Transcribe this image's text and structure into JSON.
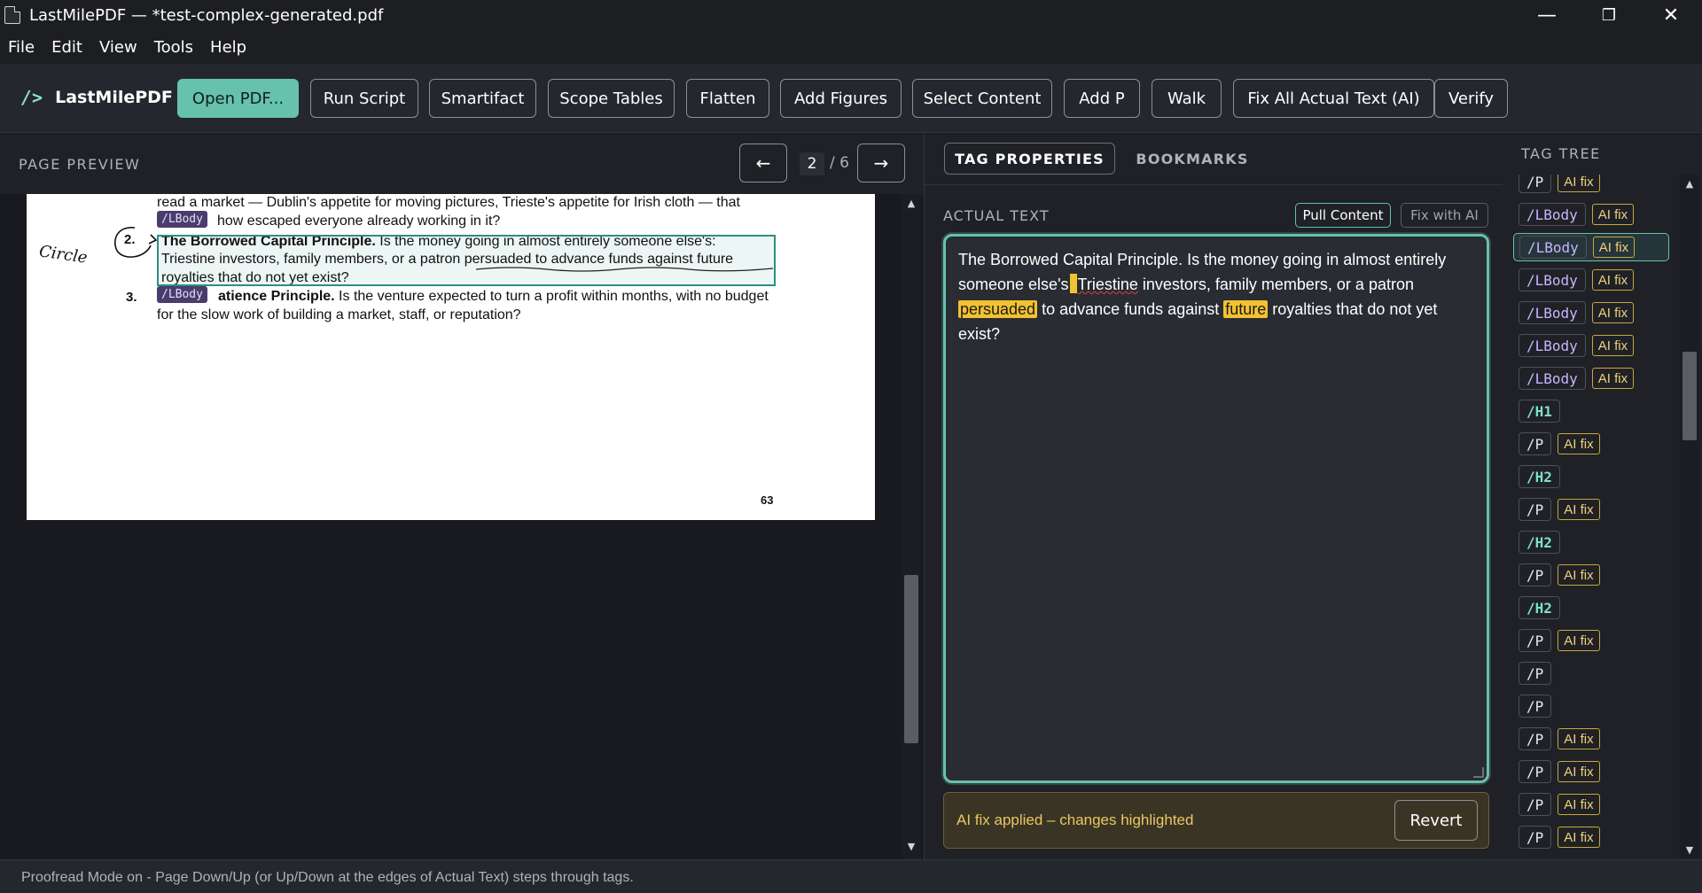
{
  "window": {
    "title": "LastMilePDF — *test-complex-generated.pdf",
    "minimize": "—",
    "maximize": "❐",
    "close": "✕"
  },
  "menu": [
    "File",
    "Edit",
    "View",
    "Tools",
    "Help"
  ],
  "brand": {
    "mark": "/>",
    "name": "LastMilePDF"
  },
  "toolbar": {
    "buttons": [
      "Open PDF...",
      "Run Script",
      "Smartifact",
      "Scope Tables",
      "Flatten",
      "Add Figures",
      "Select Content",
      "Add P",
      "Walk",
      "Fix All Actual Text (AI)",
      "Verify"
    ]
  },
  "preview": {
    "label": "PAGE PREVIEW",
    "prev": "←",
    "next": "→",
    "page": "2",
    "total": "/ 6",
    "lines": {
      "line1": "read a market — Dublin's appetite for moving pictures, Trieste's appetite for Irish cloth — that",
      "line2": "how escaped everyone already working in it?",
      "num2": "2.",
      "sel1_bold": "The Borrowed Capital Principle.",
      "sel1": " Is the money going in almost entirely someone else's:",
      "sel2": "Triestine investors, family members, or a patron persuaded to advance funds against future",
      "sel3": "royalties that do not yet exist?",
      "num3": "3.",
      "line3_bold": "atience Principle.",
      "line3": " Is the venture expected to turn a profit within months, with no budget",
      "line4": "for the slow work of building a market, staff, or reputation?",
      "handwriting": "Circle",
      "footer": "63"
    },
    "chip": "/LBody"
  },
  "tabs": {
    "active": "TAG PROPERTIES",
    "inactive": "BOOKMARKS"
  },
  "actual_text": {
    "label": "ACTUAL TEXT",
    "pull": "Pull Content",
    "fix": "Fix with AI",
    "part1": "The Borrowed Capital Principle. Is the money going in almost entirely someone else's",
    "part2": "Triestine",
    "part3": " investors, family members, or a patron ",
    "hl1": "persuaded",
    "part4": " to advance funds against ",
    "hl2": "future",
    "part5": " royalties that do not yet exist?"
  },
  "ai_status": {
    "message": "AI fix applied – changes highlighted",
    "revert": "Revert"
  },
  "tree": {
    "label": "TAG TREE",
    "items": [
      {
        "tag": "/P",
        "kind": "p",
        "aifix": "AI fix"
      },
      {
        "tag": "/LBody",
        "kind": "lbody",
        "aifix": "AI fix"
      },
      {
        "tag": "/LBody",
        "kind": "lbody",
        "aifix": "AI fix",
        "selected": true
      },
      {
        "tag": "/LBody",
        "kind": "lbody",
        "aifix": "AI fix"
      },
      {
        "tag": "/LBody",
        "kind": "lbody",
        "aifix": "AI fix"
      },
      {
        "tag": "/LBody",
        "kind": "lbody",
        "aifix": "AI fix"
      },
      {
        "tag": "/LBody",
        "kind": "lbody",
        "aifix": "AI fix"
      },
      {
        "tag": "/H1",
        "kind": "h",
        "aifix": ""
      },
      {
        "tag": "/P",
        "kind": "p",
        "aifix": "AI fix"
      },
      {
        "tag": "/H2",
        "kind": "h",
        "aifix": ""
      },
      {
        "tag": "/P",
        "kind": "p",
        "aifix": "AI fix"
      },
      {
        "tag": "/H2",
        "kind": "h",
        "aifix": ""
      },
      {
        "tag": "/P",
        "kind": "p",
        "aifix": "AI fix"
      },
      {
        "tag": "/H2",
        "kind": "h",
        "aifix": ""
      },
      {
        "tag": "/P",
        "kind": "p",
        "aifix": "AI fix"
      },
      {
        "tag": "/P",
        "kind": "p",
        "aifix": ""
      },
      {
        "tag": "/P",
        "kind": "p",
        "aifix": ""
      },
      {
        "tag": "/P",
        "kind": "p",
        "aifix": "AI fix"
      },
      {
        "tag": "/P",
        "kind": "p",
        "aifix": "AI fix"
      },
      {
        "tag": "/P",
        "kind": "p",
        "aifix": "AI fix"
      },
      {
        "tag": "/P",
        "kind": "p",
        "aifix": "AI fix"
      }
    ]
  },
  "status": "Proofread Mode on - Page Down/Up (or Up/Down at the edges of Actual Text) steps through tags.",
  "colors": {
    "accent": "#66c1ad",
    "highlight": "#f2c230",
    "lbody": "#c5b6ff"
  }
}
